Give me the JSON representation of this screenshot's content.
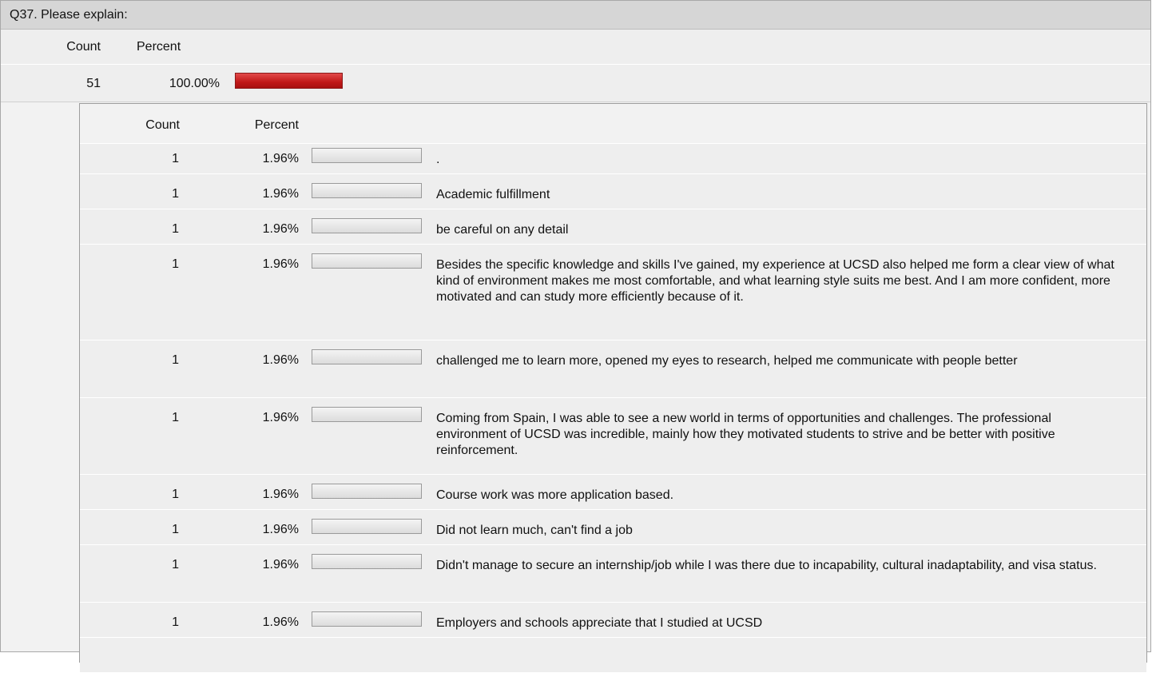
{
  "question": {
    "title": "Q37. Please explain:"
  },
  "summary": {
    "count_header": "Count",
    "percent_header": "Percent",
    "count": "51",
    "percent": "100.00%",
    "bar_fraction": 1.0
  },
  "responses": {
    "count_header": "Count",
    "percent_header": "Percent",
    "rows": [
      {
        "count": "1",
        "percent": "1.96%",
        "text": "."
      },
      {
        "count": "1",
        "percent": "1.96%",
        "text": "Academic fulfillment"
      },
      {
        "count": "1",
        "percent": "1.96%",
        "text": "be careful on any detail"
      },
      {
        "count": "1",
        "percent": "1.96%",
        "text": "Besides the specific knowledge and skills I've gained, my experience at UCSD also helped me form a clear view of what kind of environment makes me most comfortable, and what learning style suits me best. And I am more confident, more motivated and can study more efficiently because of it."
      },
      {
        "count": "1",
        "percent": "1.96%",
        "text": "challenged me to learn more, opened my eyes to research, helped me communicate with people better"
      },
      {
        "count": "1",
        "percent": "1.96%",
        "text": "Coming from Spain, I was able to see a new world in terms of opportunities and challenges. The professional environment of UCSD was incredible, mainly how they motivated students to strive and be better with positive reinforcement."
      },
      {
        "count": "1",
        "percent": "1.96%",
        "text": "Course work was more application based."
      },
      {
        "count": "1",
        "percent": "1.96%",
        "text": "Did not learn much, can't find a job"
      },
      {
        "count": "1",
        "percent": "1.96%",
        "text": "Didn't manage to secure an internship/job while I was there due to incapability, cultural inadaptability, and visa status."
      },
      {
        "count": "1",
        "percent": "1.96%",
        "text": "Employers and schools appreciate that I studied at UCSD"
      },
      {
        "count": "",
        "percent": "",
        "text": ""
      }
    ]
  },
  "colors": {
    "summary_bar": "#c01818",
    "response_bar": "#dcdcdc",
    "header_bg": "#d6d6d6",
    "row_bg": "#eeeeee"
  }
}
